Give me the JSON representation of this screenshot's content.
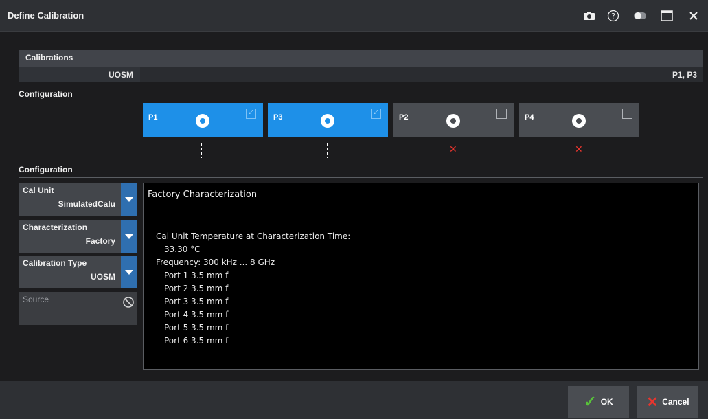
{
  "window": {
    "title": "Define Calibration",
    "icons": [
      "camera-icon",
      "help-icon",
      "toggle-icon",
      "maximize-icon",
      "close-icon"
    ]
  },
  "calibrations": {
    "header": "Calibrations",
    "row": {
      "name": "UOSM",
      "ports": "P1, P3"
    }
  },
  "configuration_top": {
    "label": "Configuration"
  },
  "ports": [
    {
      "label": "P1",
      "state": "active",
      "checked": true
    },
    {
      "label": "P3",
      "state": "active",
      "checked": true
    },
    {
      "label": "P2",
      "state": "inactive",
      "checked": false
    },
    {
      "label": "P4",
      "state": "inactive",
      "checked": false
    }
  ],
  "configuration_bottom": {
    "label": "Configuration"
  },
  "settings": {
    "cal_unit": {
      "label": "Cal Unit",
      "value": "SimulatedCalu"
    },
    "characterization": {
      "label": "Characterization",
      "value": "Factory"
    },
    "calibration_type": {
      "label": "Calibration Type",
      "value": "UOSM"
    },
    "source": {
      "label": "Source"
    }
  },
  "info": {
    "heading": "Factory Characterization",
    "lines": [
      "Cal Unit Temperature at Characterization Time:",
      "33.30 °C",
      "Frequency: 300 kHz ... 8 GHz",
      "Port 1 3.5 mm f",
      "Port 2 3.5 mm f",
      "Port 3 3.5 mm f",
      "Port 4 3.5 mm f",
      "Port 5 3.5 mm f",
      "Port 6 3.5 mm f"
    ]
  },
  "buttons": {
    "ok": "OK",
    "cancel": "Cancel"
  },
  "colors": {
    "accent": "#1e90e8",
    "ok": "#58c23a",
    "cancel": "#e8352e"
  }
}
